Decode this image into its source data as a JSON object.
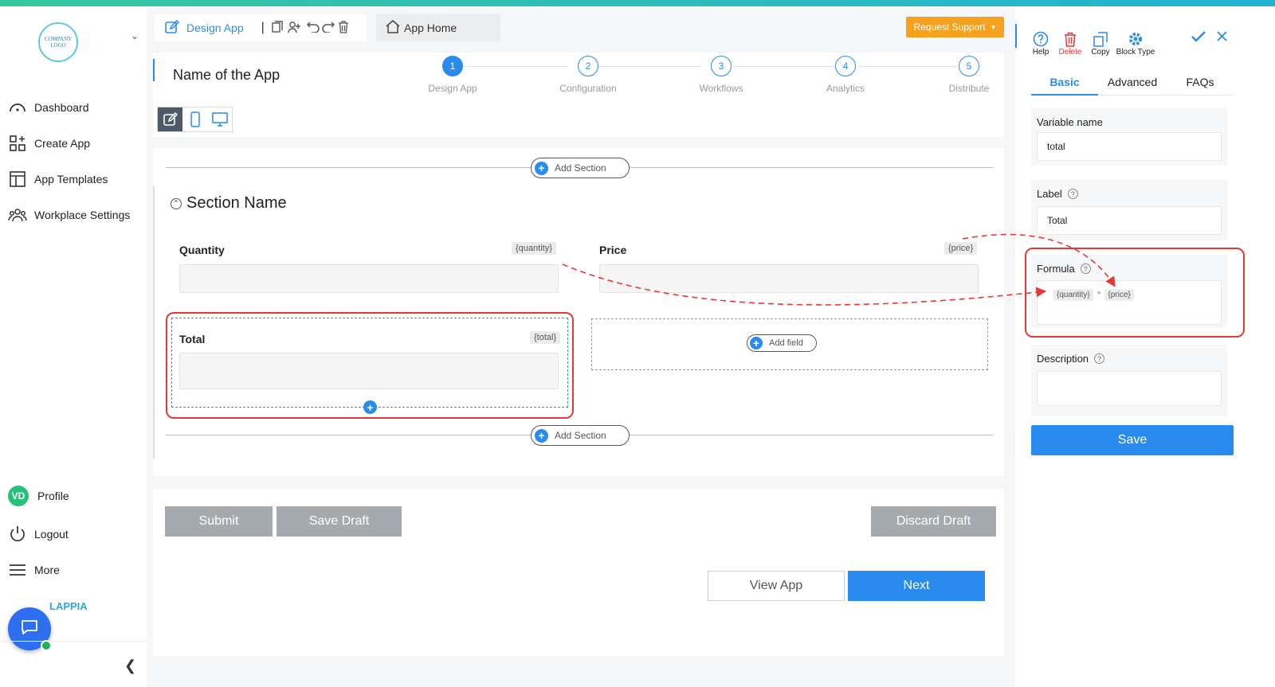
{
  "colors": {
    "accent": "#2a8bef",
    "warning": "#f7a21e",
    "danger": "#e53935",
    "status_online": "#21b05b"
  },
  "sidebar": {
    "logo_text": "COMPANY LOGO",
    "items": [
      {
        "label": "Dashboard",
        "icon": "gauge-icon"
      },
      {
        "label": "Create App",
        "icon": "grid-plus-icon"
      },
      {
        "label": "App Templates",
        "icon": "template-icon"
      },
      {
        "label": "Workplace Settings",
        "icon": "people-icon"
      }
    ],
    "profile": {
      "initials": "VD",
      "label": "Profile"
    },
    "logout": "Logout",
    "more": "More",
    "brand": "LAPPIA"
  },
  "header": {
    "design_tab": "Design App",
    "home_tab": "App Home",
    "request_support": "Request Support",
    "app_name": "Name of the App"
  },
  "steps": [
    {
      "num": "1",
      "label": "Design App",
      "active": true
    },
    {
      "num": "2",
      "label": "Configuration",
      "active": false
    },
    {
      "num": "3",
      "label": "Workflows",
      "active": false
    },
    {
      "num": "4",
      "label": "Analytics",
      "active": false
    },
    {
      "num": "5",
      "label": "Distribute",
      "active": false
    }
  ],
  "canvas": {
    "add_section": "Add Section",
    "section_name": "Section Name",
    "fields": [
      {
        "label": "Quantity",
        "var": "{quantity}"
      },
      {
        "label": "Price",
        "var": "{price}"
      },
      {
        "label": "Total",
        "var": "{total}"
      }
    ],
    "add_field": "Add field"
  },
  "actions": {
    "submit": "Submit",
    "save_draft": "Save Draft",
    "discard_draft": "Discard Draft",
    "view_app": "View App",
    "next": "Next"
  },
  "right_panel": {
    "tools": {
      "help": "Help",
      "delete": "Delete",
      "copy": "Copy",
      "block_type": "Block Type"
    },
    "tabs": [
      "Basic",
      "Advanced",
      "FAQs"
    ],
    "variable_name_label": "Variable name",
    "variable_name_value": "total",
    "label_label": "Label",
    "label_value": "Total",
    "formula_label": "Formula",
    "formula": {
      "left": "{quantity}",
      "op": "*",
      "right": "{price}"
    },
    "description_label": "Description",
    "description_value": "",
    "save": "Save"
  }
}
